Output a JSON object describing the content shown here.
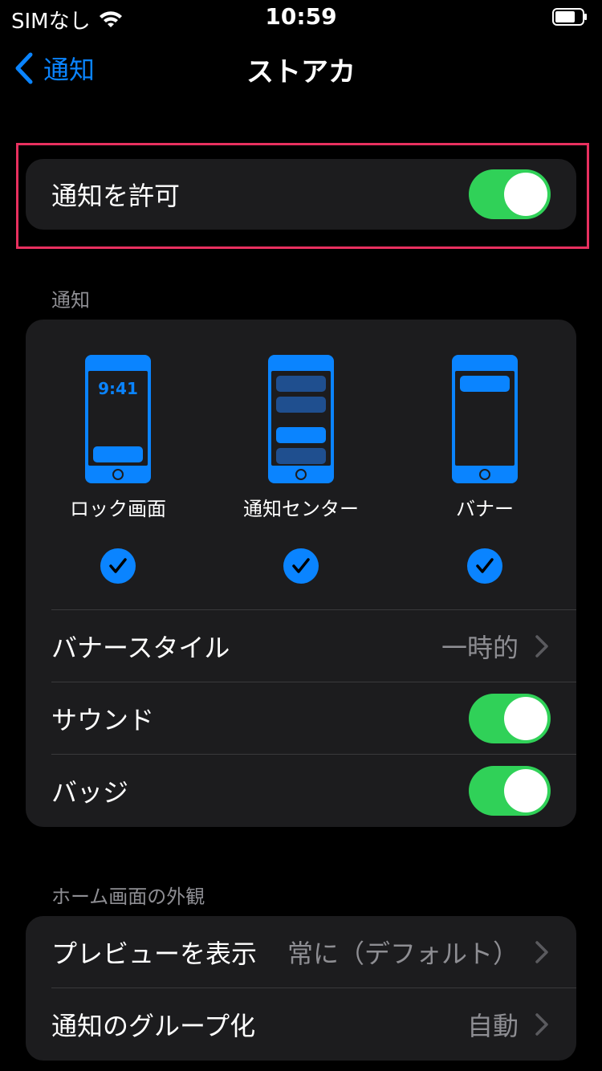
{
  "status_bar": {
    "carrier": "SIMなし",
    "time": "10:59"
  },
  "nav": {
    "back_label": "通知",
    "title": "ストアカ"
  },
  "allow": {
    "label": "通知を許可",
    "on": true
  },
  "notifications_section": {
    "header": "通知",
    "styles": [
      {
        "label": "ロック画面",
        "checked": true,
        "lock_time": "9:41"
      },
      {
        "label": "通知センター",
        "checked": true
      },
      {
        "label": "バナー",
        "checked": true
      }
    ],
    "banner_style": {
      "label": "バナースタイル",
      "value": "一時的"
    },
    "sound": {
      "label": "サウンド",
      "on": true
    },
    "badge": {
      "label": "バッジ",
      "on": true
    }
  },
  "home_section": {
    "header": "ホーム画面の外観",
    "show_previews": {
      "label": "プレビューを表示",
      "value": "常に（デフォルト）"
    },
    "grouping": {
      "label": "通知のグループ化",
      "value": "自動"
    }
  },
  "colors": {
    "accent": "#0a84ff",
    "toggle_on": "#30d158",
    "highlight": "#e8305f"
  }
}
